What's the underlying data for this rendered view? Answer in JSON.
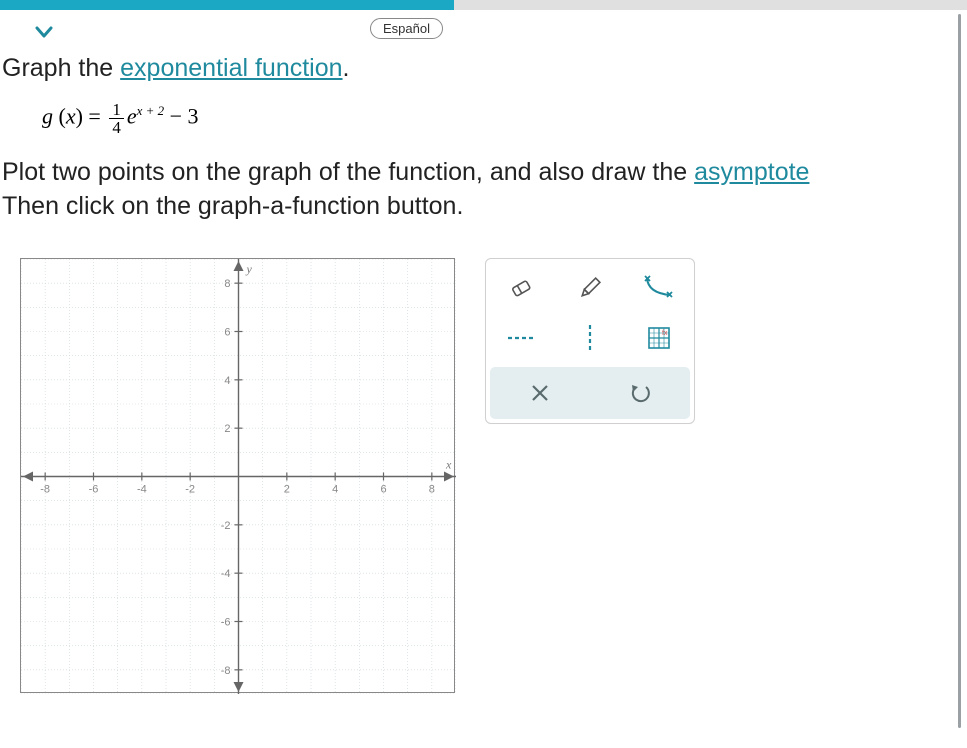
{
  "header": {
    "language_label": "Español"
  },
  "title": {
    "prefix": "Graph the ",
    "link": "exponential function",
    "suffix": "."
  },
  "equation": {
    "fn": "g",
    "var": "x",
    "frac_num": "1",
    "frac_den": "4",
    "base": "e",
    "exp": "x + 2",
    "tail": " − 3"
  },
  "instructions": {
    "line1_a": "Plot two points on the graph of the function, and also draw the ",
    "line1_link": "asymptote",
    "line2": "Then click on the graph-a-function button."
  },
  "graph": {
    "xmin": -9,
    "xmax": 9,
    "ymin": -9,
    "ymax": 9,
    "xticks": [
      -8,
      -6,
      -4,
      -2,
      2,
      4,
      6,
      8
    ],
    "yticks": [
      -8,
      -6,
      -4,
      -2,
      2,
      4,
      6,
      8
    ],
    "xlabel": "x",
    "ylabel": "y"
  },
  "tools": {
    "eraser": "eraser-icon",
    "pencil": "pencil-icon",
    "curve": "curve-icon",
    "hline": "hline-icon",
    "vline": "vline-icon",
    "grid": "grid-icon",
    "clear": "clear-icon",
    "undo": "undo-icon"
  }
}
